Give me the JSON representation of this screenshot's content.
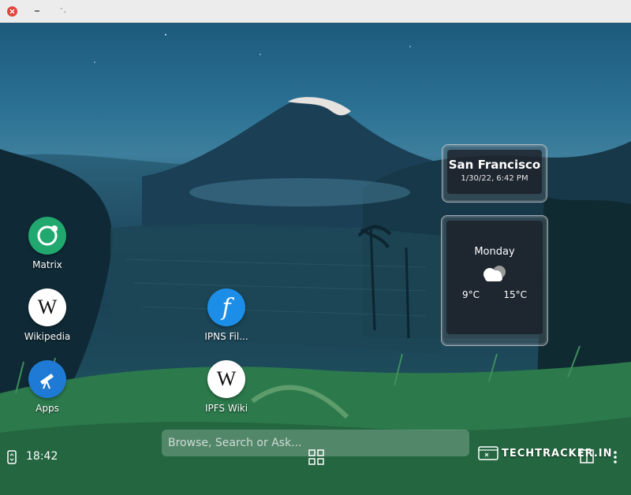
{
  "window": {
    "controls": [
      "close-icon",
      "minimize-icon",
      "maximize-icon"
    ]
  },
  "desktop": {
    "apps": [
      {
        "label": "Matrix",
        "icon": "matrix-icon"
      },
      {
        "label": "Wikipedia",
        "icon": "wikipedia-icon",
        "glyph": "W"
      },
      {
        "label": "Apps",
        "icon": "telescope-icon"
      },
      {
        "label": "IPNS Fil...",
        "icon": "filecoin-icon",
        "glyph": "f"
      },
      {
        "label": "IPFS Wiki",
        "icon": "wikipedia-icon",
        "glyph": "W"
      }
    ]
  },
  "clock_widget": {
    "city": "San Francisco",
    "datetime": "1/30/22, 6:42 PM"
  },
  "weather_widget": {
    "day": "Monday",
    "condition_icon": "cloud-icon",
    "low": "9°C",
    "high": "15°C"
  },
  "search": {
    "placeholder": "Browse, Search or Ask..."
  },
  "panel": {
    "time": "18:42",
    "left_icon": "device-icon",
    "center_icon": "app-grid-icon",
    "right_icons": [
      "window-icon",
      "more-icon"
    ]
  },
  "watermark": {
    "text": "TECHTRACKER.IN"
  },
  "colors": {
    "close": "#e0443e",
    "matrix": "#21a86f",
    "filecoin": "#1c8ee8",
    "apps": "#1e7ad4"
  }
}
